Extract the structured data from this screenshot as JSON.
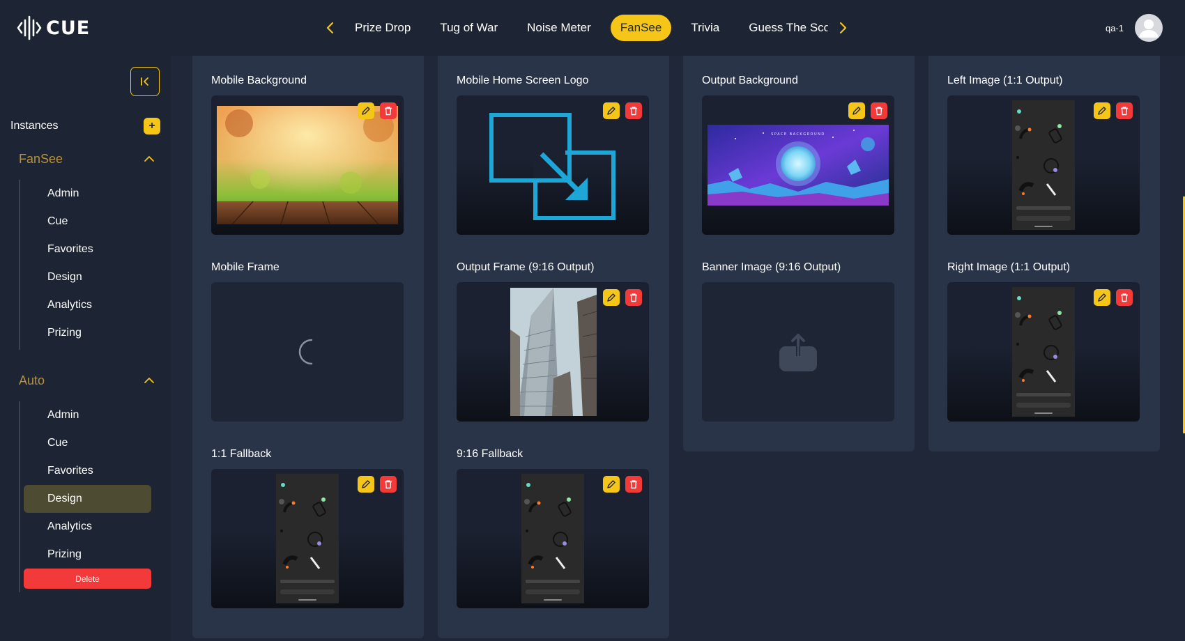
{
  "app": {
    "logo_text": "CUE"
  },
  "nav": {
    "tabs": [
      {
        "label": "Prize Drop"
      },
      {
        "label": "Tug of War"
      },
      {
        "label": "Noise Meter"
      },
      {
        "label": "FanSee",
        "active": true
      },
      {
        "label": "Trivia"
      },
      {
        "label": "Guess The Sco"
      }
    ]
  },
  "user": {
    "name": "qa-1"
  },
  "sidebar": {
    "instances_label": "Instances",
    "add_label": "+",
    "groups": [
      {
        "title": "FanSee",
        "items": [
          {
            "label": "Admin"
          },
          {
            "label": "Cue"
          },
          {
            "label": "Favorites"
          },
          {
            "label": "Design"
          },
          {
            "label": "Analytics"
          },
          {
            "label": "Prizing"
          }
        ]
      },
      {
        "title": "Auto",
        "items": [
          {
            "label": "Admin"
          },
          {
            "label": "Cue"
          },
          {
            "label": "Favorites"
          },
          {
            "label": "Design",
            "active": true
          },
          {
            "label": "Analytics"
          },
          {
            "label": "Prizing"
          }
        ]
      }
    ],
    "delete_label": "Delete"
  },
  "cards": {
    "mobile_background": {
      "title": "Mobile Background"
    },
    "mobile_home_screen_logo": {
      "title": "Mobile Home Screen Logo"
    },
    "output_background": {
      "title": "Output Background",
      "image_caption": "SPACE BACKGROUND"
    },
    "left_image": {
      "title": "Left Image (1:1 Output)"
    },
    "mobile_frame": {
      "title": "Mobile Frame"
    },
    "output_frame": {
      "title": "Output Frame (9:16 Output)"
    },
    "banner_image": {
      "title": "Banner Image (9:16 Output)"
    },
    "right_image": {
      "title": "Right Image (1:1 Output)"
    },
    "fallback_1_1": {
      "title": "1:1 Fallback"
    },
    "fallback_9_16": {
      "title": "9:16 Fallback"
    }
  },
  "colors": {
    "accent": "#f5c518",
    "danger": "#f23a3a",
    "background": "#1d2433",
    "panel": "#2a3448",
    "group_title": "#b8913d"
  },
  "icons": [
    "collapse-icon",
    "plus-icon",
    "chevron-up-icon",
    "chevron-left-icon",
    "chevron-right-icon",
    "pencil-icon",
    "trash-icon",
    "upload-icon",
    "spinner-icon",
    "user-icon"
  ]
}
